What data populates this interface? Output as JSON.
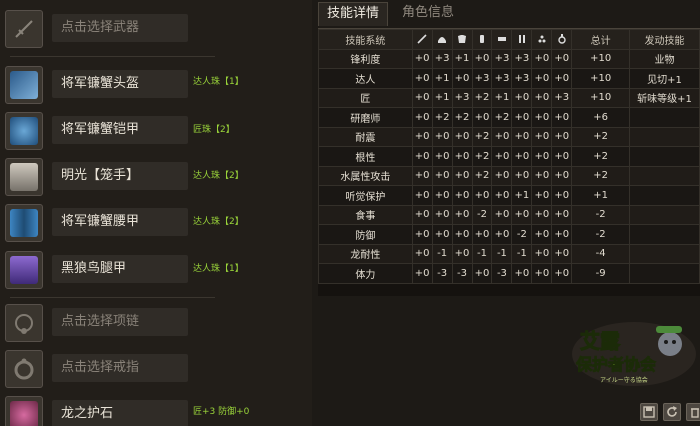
{
  "equipment": {
    "weapon": {
      "label": "点击选择武器",
      "deco": ""
    },
    "head": {
      "label": "将军镰蟹头盔",
      "deco": "达人珠【1】"
    },
    "chest": {
      "label": "将军镰蟹铠甲",
      "deco": "匠珠【2】"
    },
    "arms": {
      "label": "明光【笼手】",
      "deco": "达人珠【2】"
    },
    "waist": {
      "label": "将军镰蟹腰甲",
      "deco": "达人珠【2】"
    },
    "legs": {
      "label": "黑狼鸟腿甲",
      "deco": "达人珠【1】"
    },
    "necklace": {
      "label": "点击选择项链",
      "deco": ""
    },
    "ring": {
      "label": "点击选择戒指",
      "deco": ""
    },
    "talisman": {
      "label": "龙之护石",
      "deco": "匠+3 防御+0"
    }
  },
  "tabs": {
    "skill_detail": "技能详情",
    "char_info": "角色信息"
  },
  "table": {
    "headers": {
      "system": "技能系统",
      "total": "总计",
      "activated": "发动技能"
    },
    "header_icons": [
      "weapon-icon",
      "head-icon",
      "chest-icon",
      "arms-icon",
      "waist-icon",
      "legs-icon",
      "deco-icon",
      "talisman-icon"
    ],
    "rows": [
      {
        "name": "锋利度",
        "vals": [
          "+0",
          "+3",
          "+1",
          "+0",
          "+3",
          "+3",
          "+0",
          "+0"
        ],
        "total": "+10",
        "skill": "业物"
      },
      {
        "name": "达人",
        "vals": [
          "+0",
          "+1",
          "+0",
          "+3",
          "+3",
          "+3",
          "+0",
          "+0"
        ],
        "total": "+10",
        "skill": "见切+1"
      },
      {
        "name": "匠",
        "vals": [
          "+0",
          "+1",
          "+3",
          "+2",
          "+1",
          "+0",
          "+0",
          "+3"
        ],
        "total": "+10",
        "skill": "斩味等级+1"
      },
      {
        "name": "研磨师",
        "vals": [
          "+0",
          "+2",
          "+2",
          "+0",
          "+2",
          "+0",
          "+0",
          "+0"
        ],
        "total": "+6",
        "skill": ""
      },
      {
        "name": "耐震",
        "vals": [
          "+0",
          "+0",
          "+0",
          "+2",
          "+0",
          "+0",
          "+0",
          "+0"
        ],
        "total": "+2",
        "skill": ""
      },
      {
        "name": "根性",
        "vals": [
          "+0",
          "+0",
          "+0",
          "+2",
          "+0",
          "+0",
          "+0",
          "+0"
        ],
        "total": "+2",
        "skill": ""
      },
      {
        "name": "水属性攻击",
        "vals": [
          "+0",
          "+0",
          "+0",
          "+2",
          "+0",
          "+0",
          "+0",
          "+0"
        ],
        "total": "+2",
        "skill": ""
      },
      {
        "name": "听觉保护",
        "vals": [
          "+0",
          "+0",
          "+0",
          "+0",
          "+0",
          "+1",
          "+0",
          "+0"
        ],
        "total": "+1",
        "skill": ""
      },
      {
        "name": "食事",
        "vals": [
          "+0",
          "+0",
          "+0",
          "-2",
          "+0",
          "+0",
          "+0",
          "+0"
        ],
        "total": "-2",
        "skill": ""
      },
      {
        "name": "防御",
        "vals": [
          "+0",
          "+0",
          "+0",
          "+0",
          "+0",
          "-2",
          "+0",
          "+0"
        ],
        "total": "-2",
        "skill": ""
      },
      {
        "name": "龙耐性",
        "vals": [
          "+0",
          "-1",
          "+0",
          "-1",
          "-1",
          "-1",
          "+0",
          "+0"
        ],
        "total": "-4",
        "skill": ""
      },
      {
        "name": "体力",
        "vals": [
          "+0",
          "-3",
          "-3",
          "+0",
          "-3",
          "+0",
          "+0",
          "+0"
        ],
        "total": "-9",
        "skill": ""
      }
    ]
  },
  "logo": {
    "line1": "艾露",
    "line2": "保护者协会",
    "line3": "アイルー守る協会"
  },
  "colors": {
    "deco_green": "#9ad43a",
    "panel_bg": "#221e19"
  }
}
